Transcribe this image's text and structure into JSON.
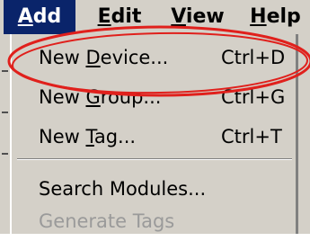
{
  "menubar": {
    "items": [
      {
        "label_pre": "",
        "mnemonic": "A",
        "label_post": "dd"
      },
      {
        "label_pre": "",
        "mnemonic": "E",
        "label_post": "dit"
      },
      {
        "label_pre": "",
        "mnemonic": "V",
        "label_post": "iew"
      },
      {
        "label_pre": "",
        "mnemonic": "H",
        "label_post": "elp"
      }
    ]
  },
  "dropdown": {
    "items": [
      {
        "label_pre": "New ",
        "mnemonic": "D",
        "label_post": "evice...",
        "shortcut": "Ctrl+D",
        "enabled": true
      },
      {
        "label_pre": "New ",
        "mnemonic": "G",
        "label_post": "roup...",
        "shortcut": "Ctrl+G",
        "enabled": true
      },
      {
        "label_pre": "New ",
        "mnemonic": "T",
        "label_post": "ag...",
        "shortcut": "Ctrl+T",
        "enabled": true
      },
      {
        "label_pre": "Search Modules...",
        "mnemonic": "",
        "label_post": "",
        "shortcut": "",
        "enabled": true
      },
      {
        "label_pre": "Generate Tags",
        "mnemonic": "",
        "label_post": "",
        "shortcut": "",
        "enabled": false
      }
    ]
  },
  "colors": {
    "menubar_bg": "#d4d0c8",
    "active_menu_bg": "#0a246a",
    "active_menu_text": "#ffffff",
    "disabled_text": "#9a9a9a",
    "annotation": "#e0201c"
  },
  "annotation": {
    "shape": "ellipse",
    "target": "New Device..."
  }
}
